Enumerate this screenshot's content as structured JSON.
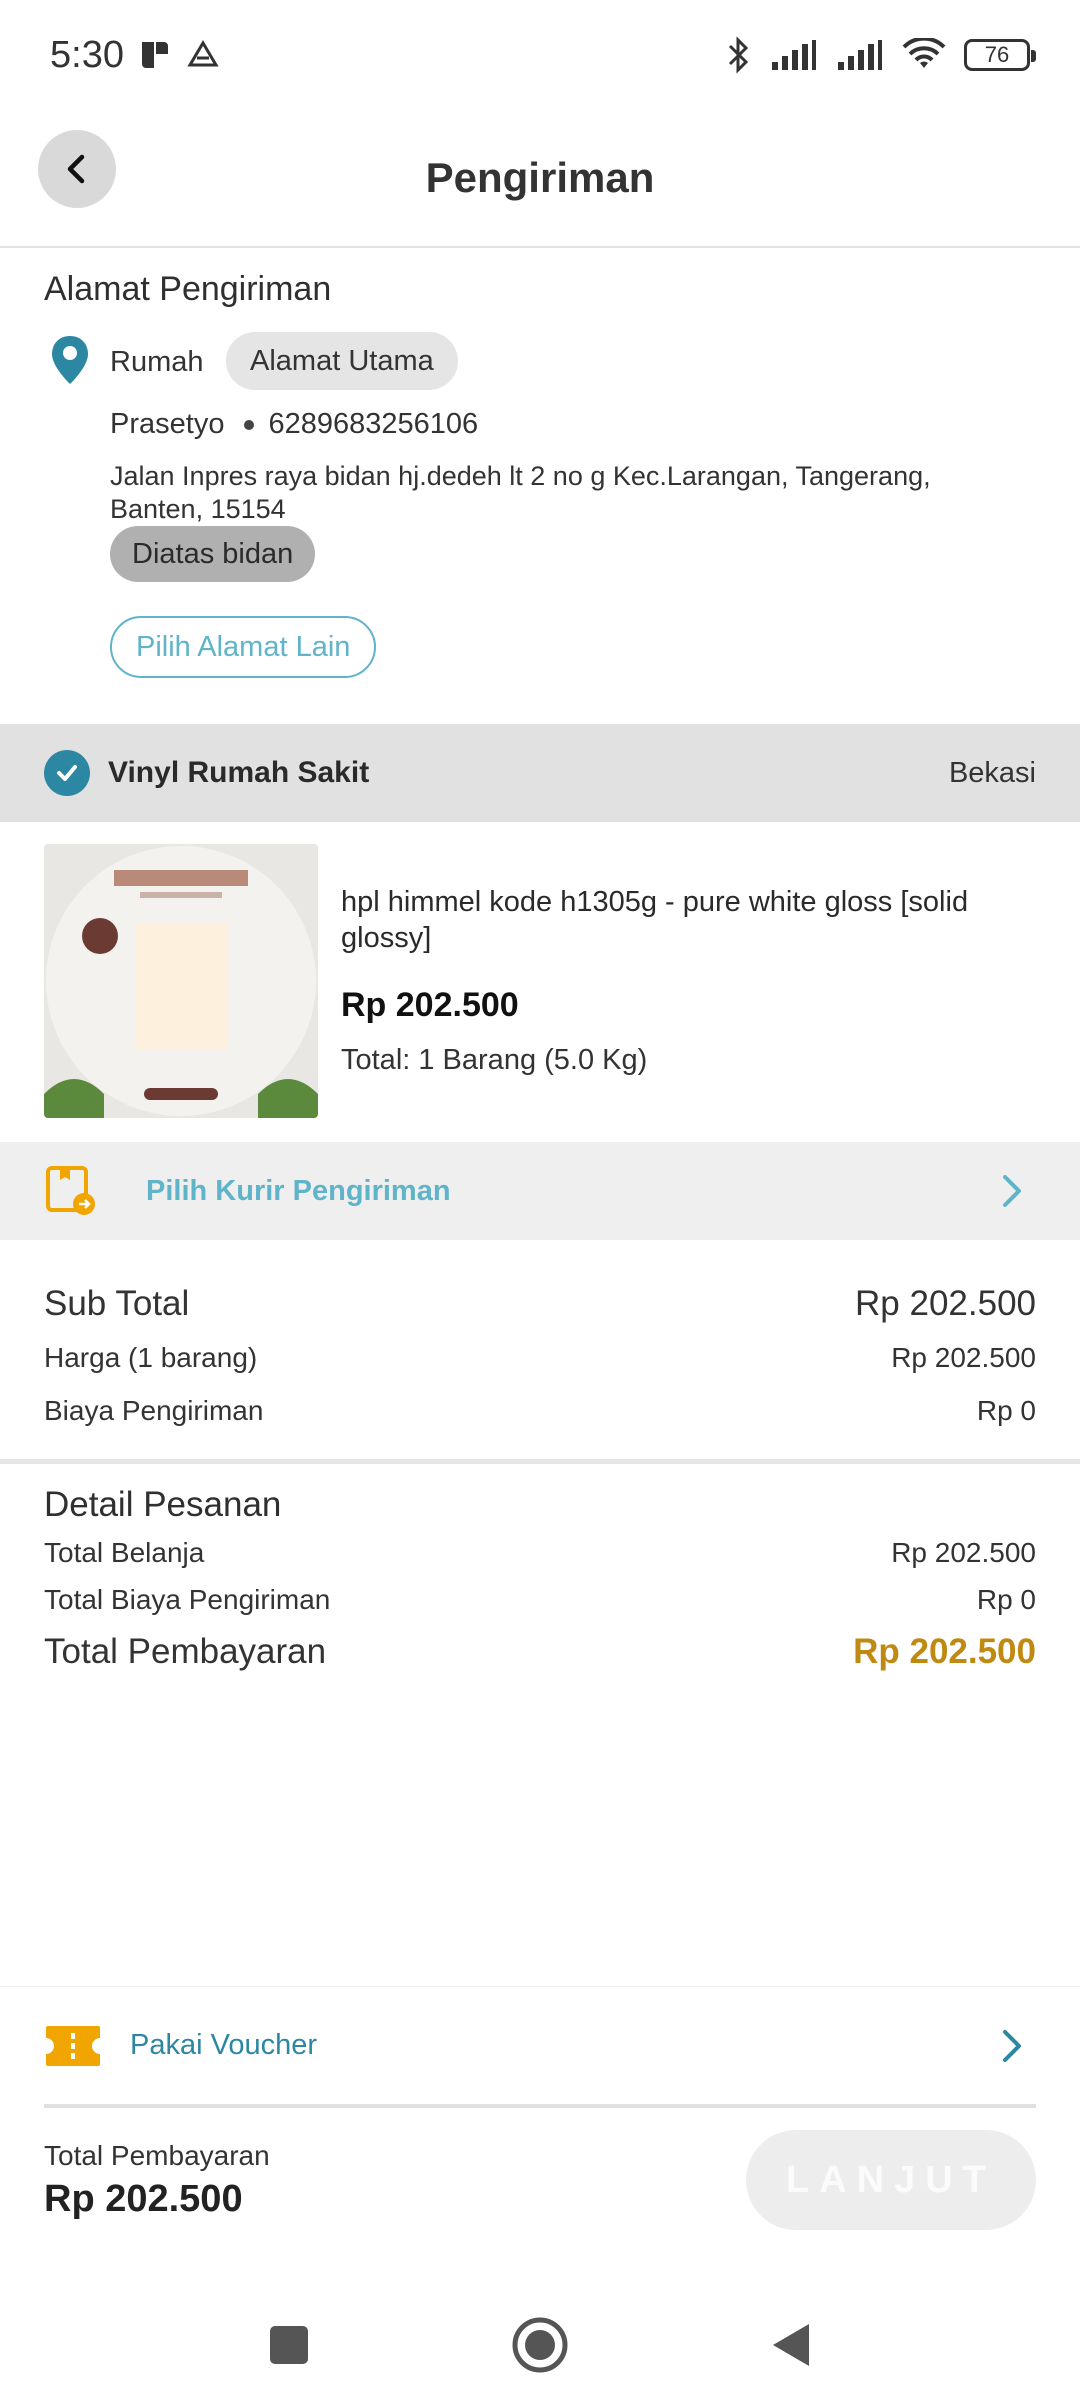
{
  "status_bar": {
    "time": "5:30",
    "battery": "76"
  },
  "header": {
    "title": "Pengiriman"
  },
  "address": {
    "section_title": "Alamat Pengiriman",
    "label": "Rumah",
    "main_badge": "Alamat Utama",
    "recipient_name": "Prasetyo",
    "phone": "6289683256106",
    "full_address": "Jalan Inpres raya bidan hj.dedeh lt 2 no g Kec.Larangan, Tangerang, Banten, 15154",
    "note": "Diatas bidan",
    "change_button": "Pilih Alamat Lain"
  },
  "store": {
    "name": "Vinyl Rumah Sakit",
    "condition": "Bekasi"
  },
  "product": {
    "name": "hpl himmel kode h1305g - pure white gloss [solid glossy]",
    "price": "Rp 202.500",
    "total": "Total: 1 Barang (5.0 Kg)"
  },
  "courier": {
    "label": "Pilih Kurir Pengiriman"
  },
  "summary": {
    "subtotal_label": "Sub Total",
    "subtotal_value": "Rp 202.500",
    "price_label": "Harga (1 barang)",
    "price_value": "Rp 202.500",
    "shipping_label": "Biaya Pengiriman",
    "shipping_value": "Rp 0"
  },
  "detail": {
    "title": "Detail Pesanan",
    "total_shopping_label": "Total Belanja",
    "total_shopping_value": "Rp 202.500",
    "total_shipping_label": "Total Biaya Pengiriman",
    "total_shipping_value": "Rp 0",
    "total_payment_label": "Total Pembayaran",
    "total_payment_value": "Rp 202.500"
  },
  "voucher": {
    "label": "Pakai Voucher"
  },
  "footer": {
    "total_label": "Total Pembayaran",
    "total_value": "Rp 202.500",
    "continue_button": "LANJUT"
  },
  "colors": {
    "accent": "#2c87a3",
    "accent_light": "#5fb4c9",
    "price_highlight": "#c08a12",
    "voucher_icon": "#f0a500"
  },
  "icons": [
    "back-arrow-icon",
    "location-pin-icon",
    "check-circle-icon",
    "courier-box-icon",
    "chevron-right-icon",
    "voucher-ticket-icon"
  ]
}
